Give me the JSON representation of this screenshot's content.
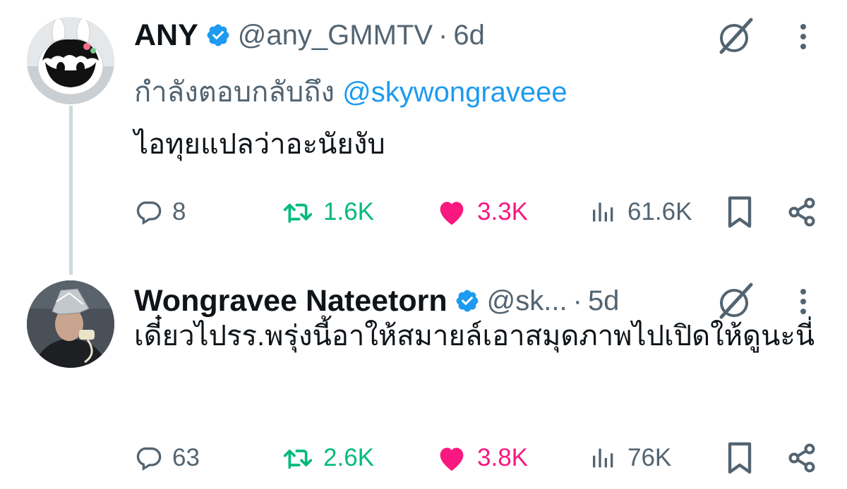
{
  "tweets": [
    {
      "name": "ANY",
      "handle": "@any_GMMTV",
      "separator": "·",
      "time": "6d",
      "replying_prefix": "กำลังตอบกลับถึง ",
      "replying_to": "@skywongraveee",
      "text": "ไอทุยแปลว่าอะนัยงับ",
      "stats": {
        "replies": "8",
        "retweets": "1.6K",
        "likes": "3.3K",
        "views": "61.6K"
      }
    },
    {
      "name": "Wongravee Nateetorn",
      "handle": "@sk...",
      "separator": "·",
      "time": "5d",
      "text": "เดี๋ยวไปรร.พรุ่งนี้อาให้สมายล์เอาสมุดภาพไปเปิดให้ดูนะนี่",
      "stats": {
        "replies": "63",
        "retweets": "2.6K",
        "likes": "3.8K",
        "views": "76K"
      }
    }
  ],
  "colors": {
    "accent": "#1d9bf0",
    "retweet": "#00ba7c",
    "like": "#f91880",
    "muted": "#536471"
  },
  "icons": [
    "verified-icon",
    "grok-icon",
    "more-icon",
    "reply-icon",
    "retweet-icon",
    "like-icon",
    "views-icon",
    "bookmark-icon",
    "share-icon"
  ]
}
